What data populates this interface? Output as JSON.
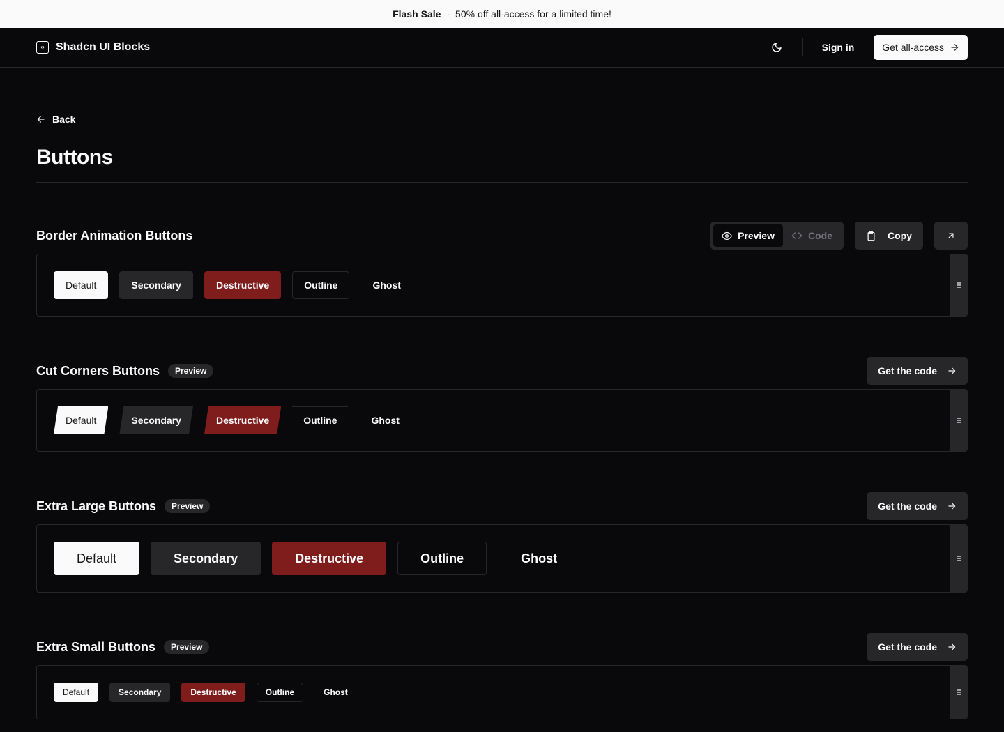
{
  "banner": {
    "title": "Flash Sale",
    "separator": "·",
    "text": "50% off all-access for a limited time!"
  },
  "nav": {
    "brand": "Shadcn UI Blocks",
    "sign_in": "Sign in",
    "cta": "Get all-access"
  },
  "page": {
    "back": "Back",
    "title": "Buttons"
  },
  "toolbar": {
    "preview": "Preview",
    "code": "Code",
    "copy": "Copy"
  },
  "sections": [
    {
      "title": "Border Animation Buttons",
      "badge": "",
      "buttons": [
        "Default",
        "Secondary",
        "Destructive",
        "Outline",
        "Ghost"
      ]
    },
    {
      "title": "Cut Corners Buttons",
      "badge": "Preview",
      "cta": "Get the code",
      "buttons": [
        "Default",
        "Secondary",
        "Destructive",
        "Outline",
        "Ghost"
      ]
    },
    {
      "title": "Extra Large Buttons",
      "badge": "Preview",
      "cta": "Get the code",
      "buttons": [
        "Default",
        "Secondary",
        "Destructive",
        "Outline",
        "Ghost"
      ]
    },
    {
      "title": "Extra Small Buttons",
      "badge": "Preview",
      "cta": "Get the code",
      "buttons": [
        "Default",
        "Secondary",
        "Destructive",
        "Outline",
        "Ghost"
      ]
    }
  ],
  "colors": {
    "background": "#09090b",
    "surface": "#27272a",
    "foreground": "#fafafa",
    "destructive": "#7f1d1d",
    "muted": "#71717a"
  },
  "icons": {
    "brand": "code-square-icon",
    "theme": "moon-icon",
    "cta": "arrow-right-icon",
    "back": "arrow-left-icon",
    "preview": "eye-icon",
    "code": "code-icon",
    "copy": "clipboard-icon",
    "external": "arrow-up-right-icon",
    "handle": "grip-vertical-icon"
  }
}
